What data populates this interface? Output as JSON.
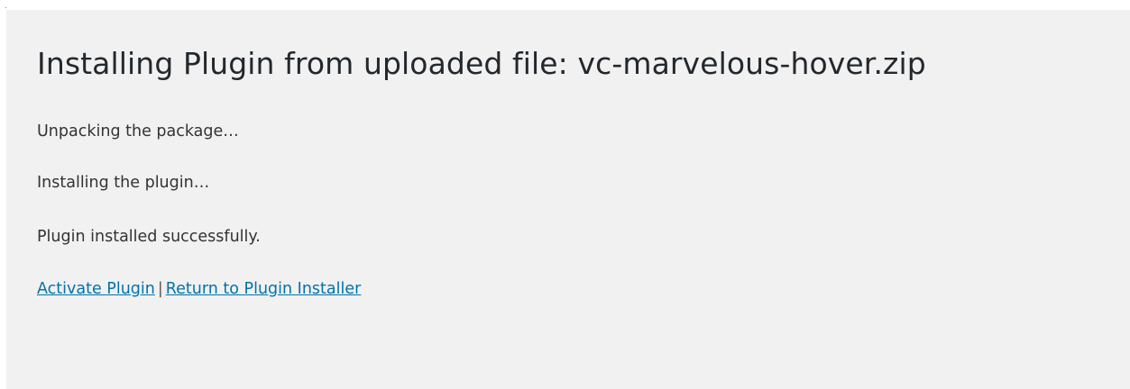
{
  "page": {
    "title": "Installing Plugin from uploaded file: vc-marvelous-hover.zip",
    "messages": [
      "Unpacking the package…",
      "Installing the plugin…",
      "Plugin installed successfully."
    ],
    "actions": {
      "activate_label": "Activate Plugin",
      "separator": "|",
      "return_label": "Return to Plugin Installer"
    }
  },
  "colors": {
    "background": "#f1f1f1",
    "text": "#23282d",
    "link": "#0073aa"
  }
}
